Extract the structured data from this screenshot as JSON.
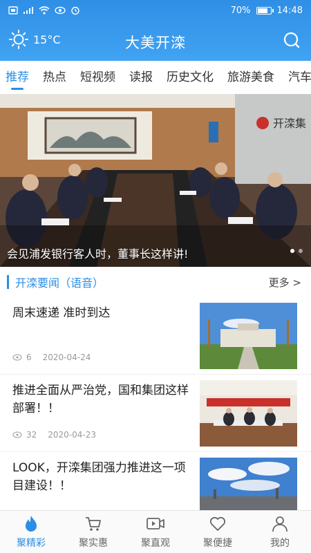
{
  "status_bar": {
    "left_icons": [
      "sim-icon",
      "signal-icon",
      "wifi-icon",
      "eye-icon",
      "alarm-icon"
    ],
    "battery": "70%",
    "battery_level": 0.7,
    "time": "14:48"
  },
  "header": {
    "temperature": "15°C",
    "title": "大美开滦"
  },
  "tabs": [
    {
      "label": "推荐",
      "active": true
    },
    {
      "label": "热点"
    },
    {
      "label": "短视频"
    },
    {
      "label": "读报"
    },
    {
      "label": "历史文化"
    },
    {
      "label": "旅游美食"
    },
    {
      "label": "汽车"
    }
  ],
  "banner": {
    "caption": "会见浦发银行客人时，董事长这样讲!",
    "sign_text": "开滦集",
    "slides": 2,
    "active_slide": 0
  },
  "section": {
    "title": "开滦要闻（语音）",
    "more": "更多 >"
  },
  "news": [
    {
      "title": "周末速递 准时到达",
      "views": "6",
      "date": "2020-04-24"
    },
    {
      "title": "推进全面从严治党，国和集团这样部署！！",
      "views": "32",
      "date": "2020-04-23"
    },
    {
      "title": " LOOK，开滦集团强力推进这一项目建设！！",
      "views": "",
      "date": ""
    }
  ],
  "bottom_nav": [
    {
      "label": "聚精彩",
      "icon": "flame-icon",
      "active": true
    },
    {
      "label": "聚实惠",
      "icon": "cart-icon"
    },
    {
      "label": "聚直观",
      "icon": "video-icon"
    },
    {
      "label": "聚便捷",
      "icon": "heart-icon"
    },
    {
      "label": "我的",
      "icon": "user-icon"
    }
  ],
  "colors": {
    "accent": "#2b8de4",
    "header": "#3a9aee"
  }
}
